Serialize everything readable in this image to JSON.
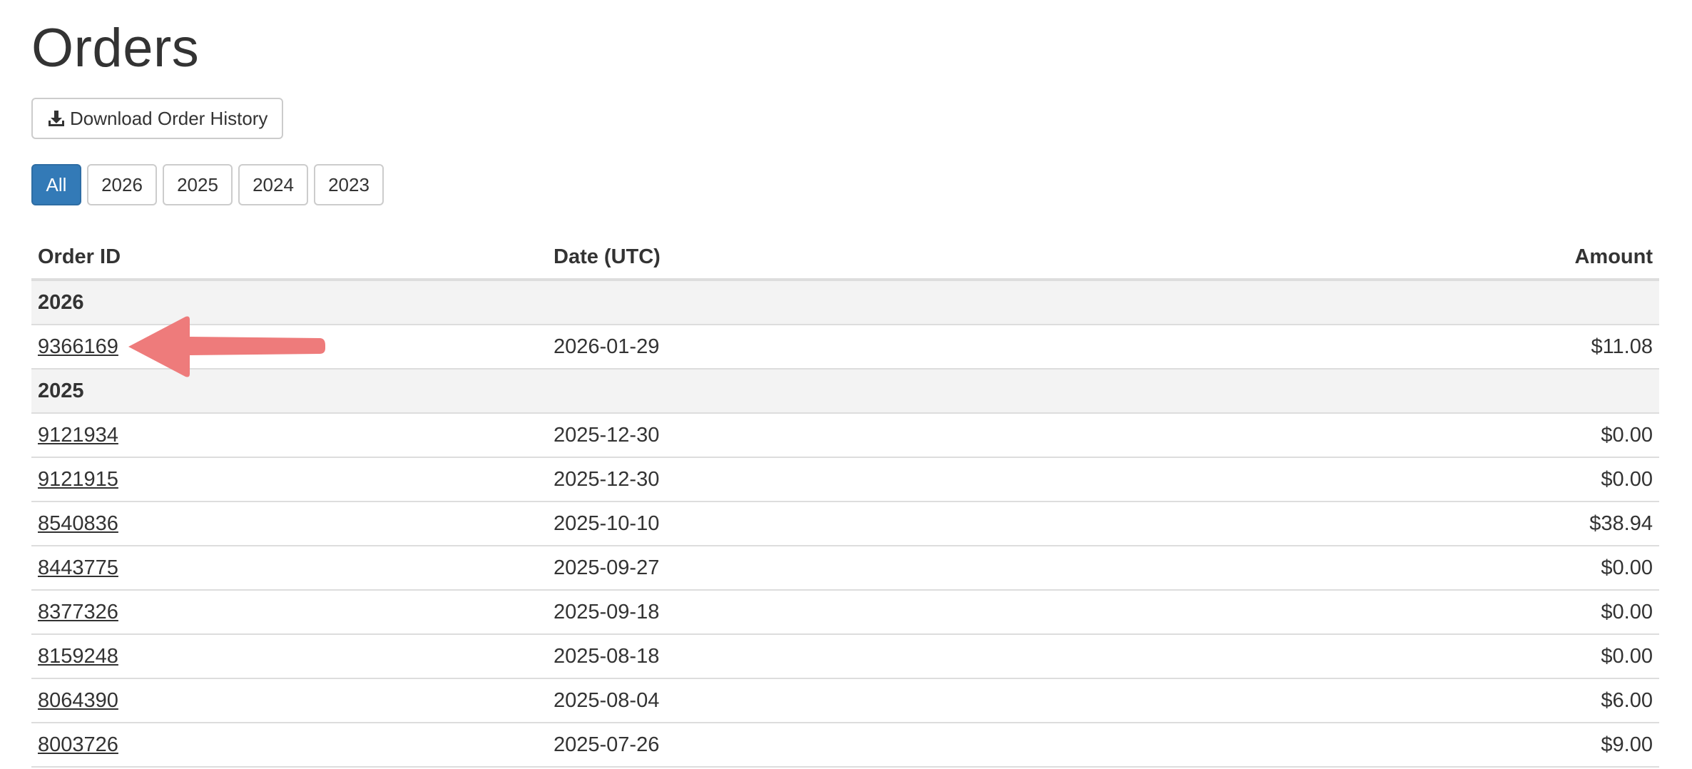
{
  "page": {
    "title": "Orders"
  },
  "toolbar": {
    "download_label": "Download Order History",
    "download_icon": "download-icon"
  },
  "year_filter": {
    "options": [
      "All",
      "2026",
      "2025",
      "2024",
      "2023"
    ],
    "selected": "All",
    "active_color": "#337ab7"
  },
  "table": {
    "headers": {
      "order_id": "Order ID",
      "date": "Date (UTC)",
      "amount": "Amount"
    },
    "groups": [
      {
        "year": "2026",
        "rows": [
          {
            "order_id": "9366169",
            "date": "2026-01-29",
            "amount": "$11.08"
          }
        ]
      },
      {
        "year": "2025",
        "rows": [
          {
            "order_id": "9121934",
            "date": "2025-12-30",
            "amount": "$0.00"
          },
          {
            "order_id": "9121915",
            "date": "2025-12-30",
            "amount": "$0.00"
          },
          {
            "order_id": "8540836",
            "date": "2025-10-10",
            "amount": "$38.94"
          },
          {
            "order_id": "8443775",
            "date": "2025-09-27",
            "amount": "$0.00"
          },
          {
            "order_id": "8377326",
            "date": "2025-09-18",
            "amount": "$0.00"
          },
          {
            "order_id": "8159248",
            "date": "2025-08-18",
            "amount": "$0.00"
          },
          {
            "order_id": "8064390",
            "date": "2025-08-04",
            "amount": "$6.00"
          },
          {
            "order_id": "8003726",
            "date": "2025-07-26",
            "amount": "$9.00"
          }
        ]
      }
    ]
  },
  "annotation": {
    "arrow_color": "#ee7b7b",
    "arrow_icon": "pointer-arrow-icon"
  }
}
